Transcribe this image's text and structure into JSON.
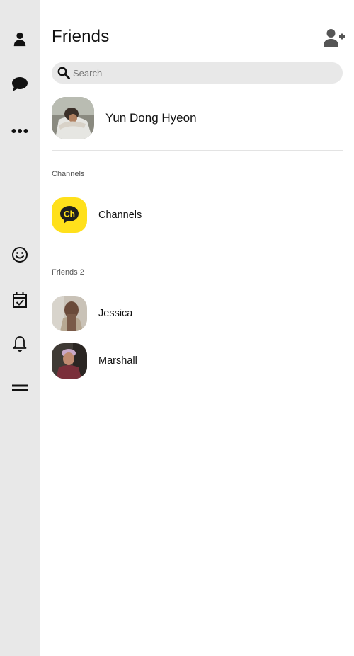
{
  "app": {
    "title": "Friends"
  },
  "sidebar": {
    "items": [
      {
        "icon": "person-icon",
        "label": "Friends"
      },
      {
        "icon": "chat-icon",
        "label": "Chats"
      },
      {
        "icon": "more-icon",
        "label": "More"
      },
      {
        "icon": "smiley-icon",
        "label": "Emoticons"
      },
      {
        "icon": "calendar-check-icon",
        "label": "Calendar"
      },
      {
        "icon": "bell-icon",
        "label": "Notifications"
      },
      {
        "icon": "menu-icon",
        "label": "Menu"
      }
    ]
  },
  "search": {
    "placeholder": "Search",
    "value": ""
  },
  "profile": {
    "name": "Yun Dong Hyeon"
  },
  "channels": {
    "section_label": "Channels",
    "item": {
      "name": "Channels",
      "logo_text": "Ch",
      "logo_color": "#FFE01B"
    }
  },
  "friends": {
    "section_label": "Friends 2",
    "list": [
      {
        "name": "Jessica"
      },
      {
        "name": "Marshall"
      }
    ]
  },
  "colors": {
    "sidebar_bg": "#e8e8e8",
    "search_bg": "#e8e8e8",
    "accent_yellow": "#FFE01B"
  }
}
